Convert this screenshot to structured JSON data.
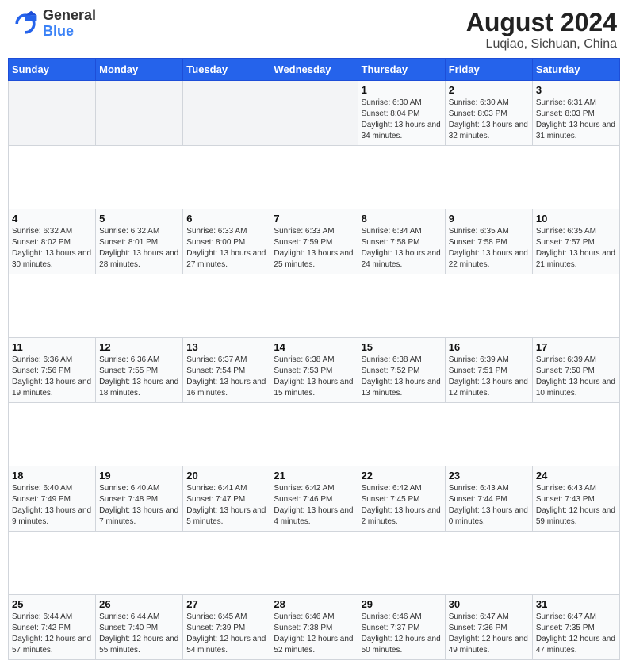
{
  "header": {
    "logo_general": "General",
    "logo_blue": "Blue",
    "title": "August 2024",
    "subtitle": "Luqiao, Sichuan, China"
  },
  "calendar": {
    "days_of_week": [
      "Sunday",
      "Monday",
      "Tuesday",
      "Wednesday",
      "Thursday",
      "Friday",
      "Saturday"
    ],
    "weeks": [
      [
        {
          "day": "",
          "sunrise": "",
          "sunset": "",
          "daylight": ""
        },
        {
          "day": "",
          "sunrise": "",
          "sunset": "",
          "daylight": ""
        },
        {
          "day": "",
          "sunrise": "",
          "sunset": "",
          "daylight": ""
        },
        {
          "day": "",
          "sunrise": "",
          "sunset": "",
          "daylight": ""
        },
        {
          "day": "1",
          "sunrise": "Sunrise: 6:30 AM",
          "sunset": "Sunset: 8:04 PM",
          "daylight": "Daylight: 13 hours and 34 minutes."
        },
        {
          "day": "2",
          "sunrise": "Sunrise: 6:30 AM",
          "sunset": "Sunset: 8:03 PM",
          "daylight": "Daylight: 13 hours and 32 minutes."
        },
        {
          "day": "3",
          "sunrise": "Sunrise: 6:31 AM",
          "sunset": "Sunset: 8:03 PM",
          "daylight": "Daylight: 13 hours and 31 minutes."
        }
      ],
      [
        {
          "day": "4",
          "sunrise": "Sunrise: 6:32 AM",
          "sunset": "Sunset: 8:02 PM",
          "daylight": "Daylight: 13 hours and 30 minutes."
        },
        {
          "day": "5",
          "sunrise": "Sunrise: 6:32 AM",
          "sunset": "Sunset: 8:01 PM",
          "daylight": "Daylight: 13 hours and 28 minutes."
        },
        {
          "day": "6",
          "sunrise": "Sunrise: 6:33 AM",
          "sunset": "Sunset: 8:00 PM",
          "daylight": "Daylight: 13 hours and 27 minutes."
        },
        {
          "day": "7",
          "sunrise": "Sunrise: 6:33 AM",
          "sunset": "Sunset: 7:59 PM",
          "daylight": "Daylight: 13 hours and 25 minutes."
        },
        {
          "day": "8",
          "sunrise": "Sunrise: 6:34 AM",
          "sunset": "Sunset: 7:58 PM",
          "daylight": "Daylight: 13 hours and 24 minutes."
        },
        {
          "day": "9",
          "sunrise": "Sunrise: 6:35 AM",
          "sunset": "Sunset: 7:58 PM",
          "daylight": "Daylight: 13 hours and 22 minutes."
        },
        {
          "day": "10",
          "sunrise": "Sunrise: 6:35 AM",
          "sunset": "Sunset: 7:57 PM",
          "daylight": "Daylight: 13 hours and 21 minutes."
        }
      ],
      [
        {
          "day": "11",
          "sunrise": "Sunrise: 6:36 AM",
          "sunset": "Sunset: 7:56 PM",
          "daylight": "Daylight: 13 hours and 19 minutes."
        },
        {
          "day": "12",
          "sunrise": "Sunrise: 6:36 AM",
          "sunset": "Sunset: 7:55 PM",
          "daylight": "Daylight: 13 hours and 18 minutes."
        },
        {
          "day": "13",
          "sunrise": "Sunrise: 6:37 AM",
          "sunset": "Sunset: 7:54 PM",
          "daylight": "Daylight: 13 hours and 16 minutes."
        },
        {
          "day": "14",
          "sunrise": "Sunrise: 6:38 AM",
          "sunset": "Sunset: 7:53 PM",
          "daylight": "Daylight: 13 hours and 15 minutes."
        },
        {
          "day": "15",
          "sunrise": "Sunrise: 6:38 AM",
          "sunset": "Sunset: 7:52 PM",
          "daylight": "Daylight: 13 hours and 13 minutes."
        },
        {
          "day": "16",
          "sunrise": "Sunrise: 6:39 AM",
          "sunset": "Sunset: 7:51 PM",
          "daylight": "Daylight: 13 hours and 12 minutes."
        },
        {
          "day": "17",
          "sunrise": "Sunrise: 6:39 AM",
          "sunset": "Sunset: 7:50 PM",
          "daylight": "Daylight: 13 hours and 10 minutes."
        }
      ],
      [
        {
          "day": "18",
          "sunrise": "Sunrise: 6:40 AM",
          "sunset": "Sunset: 7:49 PM",
          "daylight": "Daylight: 13 hours and 9 minutes."
        },
        {
          "day": "19",
          "sunrise": "Sunrise: 6:40 AM",
          "sunset": "Sunset: 7:48 PM",
          "daylight": "Daylight: 13 hours and 7 minutes."
        },
        {
          "day": "20",
          "sunrise": "Sunrise: 6:41 AM",
          "sunset": "Sunset: 7:47 PM",
          "daylight": "Daylight: 13 hours and 5 minutes."
        },
        {
          "day": "21",
          "sunrise": "Sunrise: 6:42 AM",
          "sunset": "Sunset: 7:46 PM",
          "daylight": "Daylight: 13 hours and 4 minutes."
        },
        {
          "day": "22",
          "sunrise": "Sunrise: 6:42 AM",
          "sunset": "Sunset: 7:45 PM",
          "daylight": "Daylight: 13 hours and 2 minutes."
        },
        {
          "day": "23",
          "sunrise": "Sunrise: 6:43 AM",
          "sunset": "Sunset: 7:44 PM",
          "daylight": "Daylight: 13 hours and 0 minutes."
        },
        {
          "day": "24",
          "sunrise": "Sunrise: 6:43 AM",
          "sunset": "Sunset: 7:43 PM",
          "daylight": "Daylight: 12 hours and 59 minutes."
        }
      ],
      [
        {
          "day": "25",
          "sunrise": "Sunrise: 6:44 AM",
          "sunset": "Sunset: 7:42 PM",
          "daylight": "Daylight: 12 hours and 57 minutes."
        },
        {
          "day": "26",
          "sunrise": "Sunrise: 6:44 AM",
          "sunset": "Sunset: 7:40 PM",
          "daylight": "Daylight: 12 hours and 55 minutes."
        },
        {
          "day": "27",
          "sunrise": "Sunrise: 6:45 AM",
          "sunset": "Sunset: 7:39 PM",
          "daylight": "Daylight: 12 hours and 54 minutes."
        },
        {
          "day": "28",
          "sunrise": "Sunrise: 6:46 AM",
          "sunset": "Sunset: 7:38 PM",
          "daylight": "Daylight: 12 hours and 52 minutes."
        },
        {
          "day": "29",
          "sunrise": "Sunrise: 6:46 AM",
          "sunset": "Sunset: 7:37 PM",
          "daylight": "Daylight: 12 hours and 50 minutes."
        },
        {
          "day": "30",
          "sunrise": "Sunrise: 6:47 AM",
          "sunset": "Sunset: 7:36 PM",
          "daylight": "Daylight: 12 hours and 49 minutes."
        },
        {
          "day": "31",
          "sunrise": "Sunrise: 6:47 AM",
          "sunset": "Sunset: 7:35 PM",
          "daylight": "Daylight: 12 hours and 47 minutes."
        }
      ]
    ]
  }
}
